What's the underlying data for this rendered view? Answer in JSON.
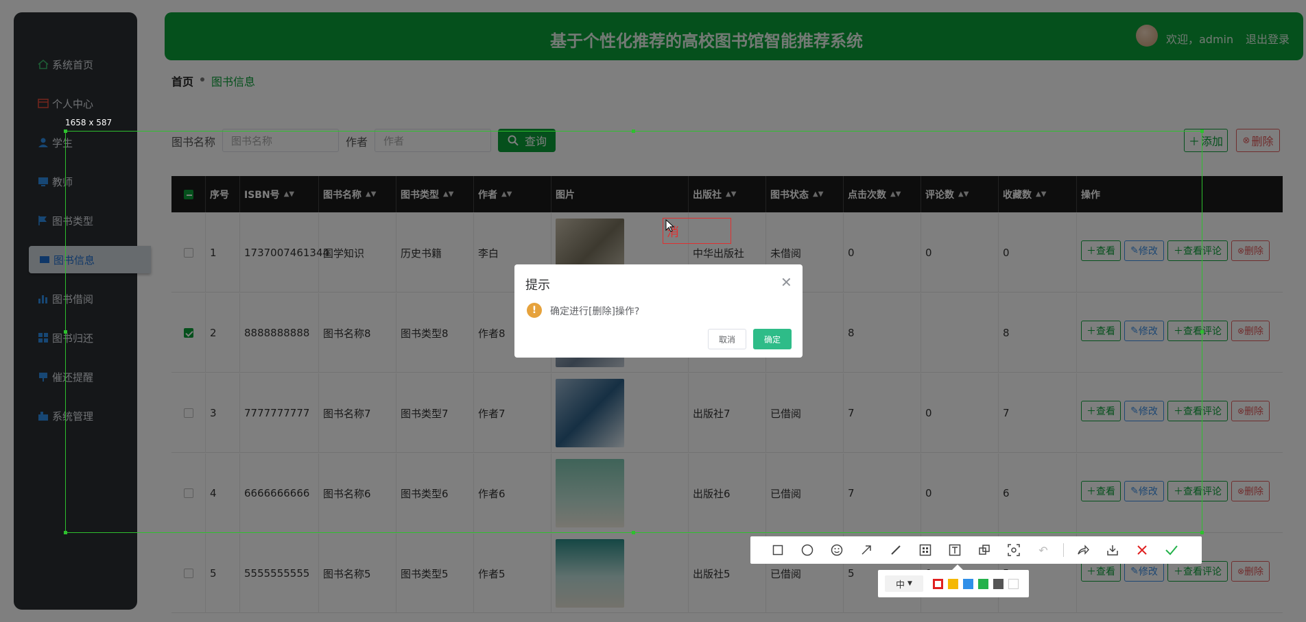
{
  "sidebar": {
    "items": [
      {
        "label": "系统首页",
        "icon": "home-icon"
      },
      {
        "label": "个人中心",
        "icon": "profile-icon"
      },
      {
        "label": "学生",
        "icon": "user-icon"
      },
      {
        "label": "教师",
        "icon": "teacher-icon"
      },
      {
        "label": "图书类型",
        "icon": "flag-icon"
      },
      {
        "label": "图书信息",
        "icon": "book-icon"
      },
      {
        "label": "图书借阅",
        "icon": "chart-icon"
      },
      {
        "label": "图书归还",
        "icon": "grid-icon"
      },
      {
        "label": "催还提醒",
        "icon": "bell-icon"
      },
      {
        "label": "系统管理",
        "icon": "settings-icon"
      }
    ]
  },
  "header": {
    "title": "基于个性化推荐的高校图书馆智能推荐系统",
    "welcome": "欢迎，admin",
    "logout": "退出登录"
  },
  "breadcrumb": {
    "home": "首页",
    "current": "图书信息"
  },
  "search": {
    "name_label": "图书名称",
    "name_placeholder": "图书名称",
    "author_label": "作者",
    "author_placeholder": "作者",
    "query_button": "查询",
    "add_button": "添加",
    "delete_button": "删除"
  },
  "table": {
    "columns": [
      "序号",
      "ISBN号",
      "图书名称",
      "图书类型",
      "作者",
      "图片",
      "出版社",
      "图书状态",
      "点击次数",
      "评论数",
      "收藏数",
      "操作"
    ],
    "actions": {
      "view": "查看",
      "edit": "修改",
      "view_comments": "查看评论",
      "delete": "删除"
    },
    "rows": [
      {
        "no": "1",
        "isbn": "1737007461344",
        "name": "国学知识",
        "type": "历史书籍",
        "author": "李白",
        "publisher": "中华出版社",
        "status": "未借阅",
        "clicks": "0",
        "comments": "0",
        "favorites": "0",
        "checked": false
      },
      {
        "no": "2",
        "isbn": "8888888888",
        "name": "图书名称8",
        "type": "图书类型8",
        "author": "作者8",
        "publisher": "",
        "status": "",
        "clicks": "8",
        "comments": "",
        "favorites": "8",
        "checked": true
      },
      {
        "no": "3",
        "isbn": "7777777777",
        "name": "图书名称7",
        "type": "图书类型7",
        "author": "作者7",
        "publisher": "出版社7",
        "status": "已借阅",
        "clicks": "7",
        "comments": "0",
        "favorites": "7",
        "checked": false
      },
      {
        "no": "4",
        "isbn": "6666666666",
        "name": "图书名称6",
        "type": "图书类型6",
        "author": "作者6",
        "publisher": "出版社6",
        "status": "已借阅",
        "clicks": "7",
        "comments": "0",
        "favorites": "6",
        "checked": false
      },
      {
        "no": "5",
        "isbn": "5555555555",
        "name": "图书名称5",
        "type": "图书类型5",
        "author": "作者5",
        "publisher": "出版社5",
        "status": "已借阅",
        "clicks": "5",
        "comments": "0",
        "favorites": "5",
        "checked": false
      }
    ]
  },
  "screenshot_tool": {
    "size_label": "1658 x 587",
    "text_annotation": "消",
    "size_option": "中",
    "colors": [
      "#e02020",
      "#f5b800",
      "#2f8fe8",
      "#24b24b",
      "#555555",
      "#ffffff"
    ]
  },
  "dialog": {
    "title": "提示",
    "message": "确定进行[删除]操作?",
    "cancel": "取消",
    "confirm": "确定"
  }
}
